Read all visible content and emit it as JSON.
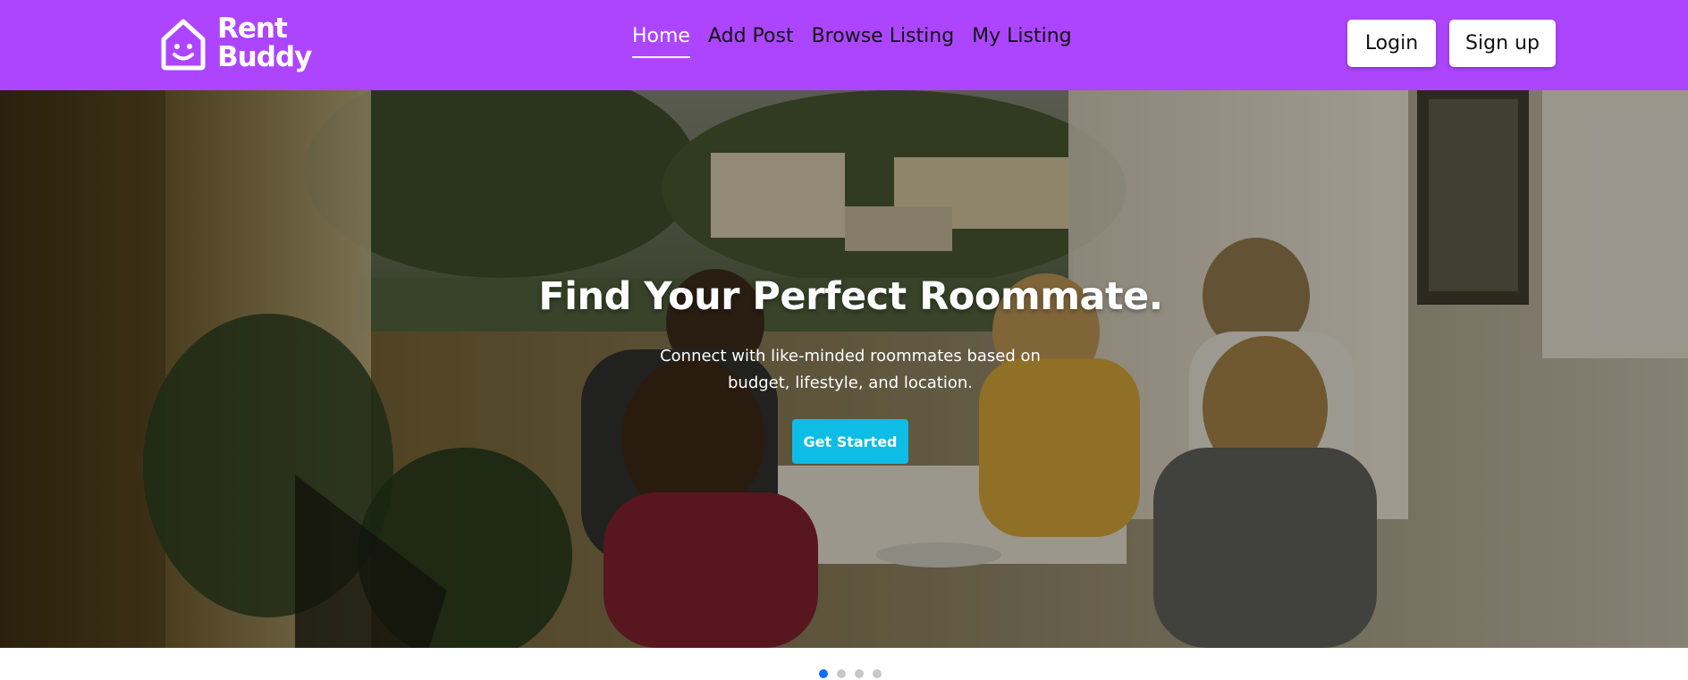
{
  "brand": {
    "line1": "Rent",
    "line2": "Buddy",
    "color": "#ad45ff"
  },
  "nav": {
    "items": [
      {
        "label": "Home",
        "active": true
      },
      {
        "label": "Add Post",
        "active": false
      },
      {
        "label": "Browse Listing",
        "active": false
      },
      {
        "label": "My Listing",
        "active": false
      }
    ]
  },
  "auth": {
    "login_label": "Login",
    "signup_label": "Sign up"
  },
  "hero": {
    "title": "Find Your Perfect Roommate.",
    "subtitle": "Connect with like-minded roommates based on budget, lifestyle, and location.",
    "cta_label": "Get Started",
    "cta_color": "#0dbde6"
  },
  "carousel": {
    "slide_count": 4,
    "active_index": 0
  }
}
